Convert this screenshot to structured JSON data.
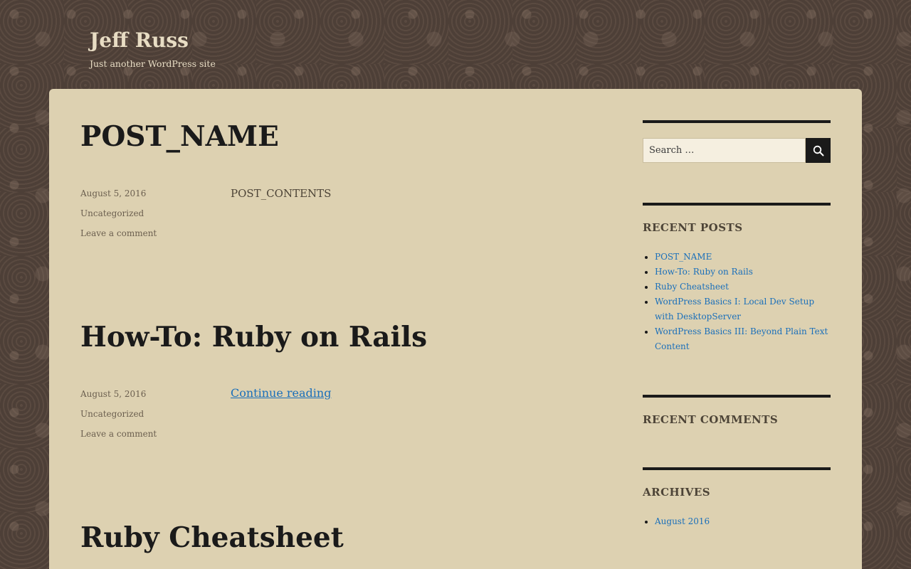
{
  "site": {
    "title": "Jeff Russ",
    "description": "Just another WordPress site"
  },
  "posts": [
    {
      "title": "POST_NAME",
      "date": "August 5, 2016",
      "category": "Uncategorized",
      "comment_link": "Leave a comment",
      "body": "POST_CONTENTS"
    },
    {
      "title": "How-To: Ruby on Rails",
      "date": "August 5, 2016",
      "category": "Uncategorized",
      "comment_link": "Leave a comment",
      "body": "Continue reading"
    },
    {
      "title": "Ruby Cheatsheet"
    }
  ],
  "sidebar": {
    "search": {
      "placeholder": "Search …",
      "icon": "search-icon"
    },
    "recent_posts": {
      "title": "RECENT POSTS",
      "items": [
        "POST_NAME",
        "How-To: Ruby on Rails",
        "Ruby Cheatsheet",
        "WordPress Basics I: Local Dev Setup with DesktopServer",
        "WordPress Basics III: Beyond Plain Text Content"
      ]
    },
    "recent_comments": {
      "title": "RECENT COMMENTS"
    },
    "archives": {
      "title": "ARCHIVES",
      "items": [
        "August 2016"
      ]
    }
  },
  "colors": {
    "background": "#4d3f37",
    "card": "#ddd1b1",
    "link": "#1a6fba",
    "text_dark": "#1a1a1a"
  }
}
